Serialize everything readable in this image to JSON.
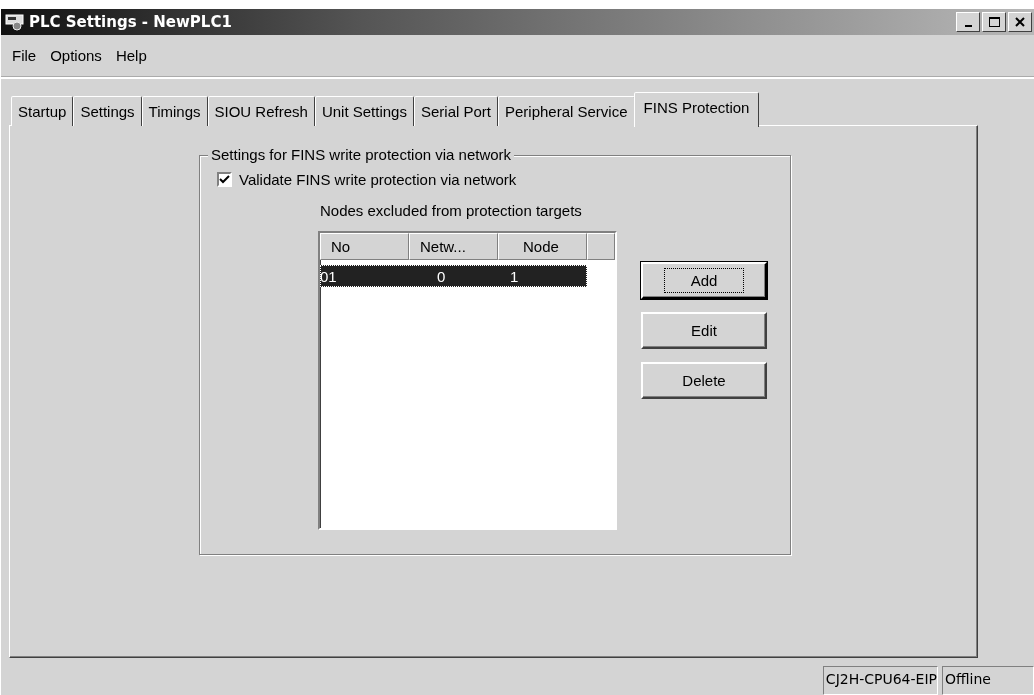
{
  "window": {
    "title": "PLC Settings - NewPLC1"
  },
  "menu": [
    {
      "label": "File"
    },
    {
      "label": "Options"
    },
    {
      "label": "Help"
    }
  ],
  "tabs": [
    {
      "label": "Startup",
      "selected": false
    },
    {
      "label": "Settings",
      "selected": false
    },
    {
      "label": "Timings",
      "selected": false
    },
    {
      "label": "SIOU Refresh",
      "selected": false
    },
    {
      "label": "Unit Settings",
      "selected": false
    },
    {
      "label": "Serial Port",
      "selected": false
    },
    {
      "label": "Peripheral Service",
      "selected": false
    },
    {
      "label": "FINS Protection",
      "selected": true
    }
  ],
  "group": {
    "title": "Settings for FINS write protection via network",
    "checkbox": {
      "label": "Validate FINS write protection via network",
      "checked": true
    },
    "list_label": "Nodes excluded from protection targets",
    "table": {
      "columns": [
        "No",
        "Netw...",
        "Node"
      ],
      "rows": [
        {
          "cells": [
            "01",
            "0",
            "1"
          ],
          "selected": true
        }
      ]
    },
    "buttons": [
      {
        "label": "Add",
        "default": true
      },
      {
        "label": "Edit",
        "default": false
      },
      {
        "label": "Delete",
        "default": false
      }
    ]
  },
  "status_bar": [
    "CJ2H-CPU64-EIP",
    "Offline"
  ]
}
